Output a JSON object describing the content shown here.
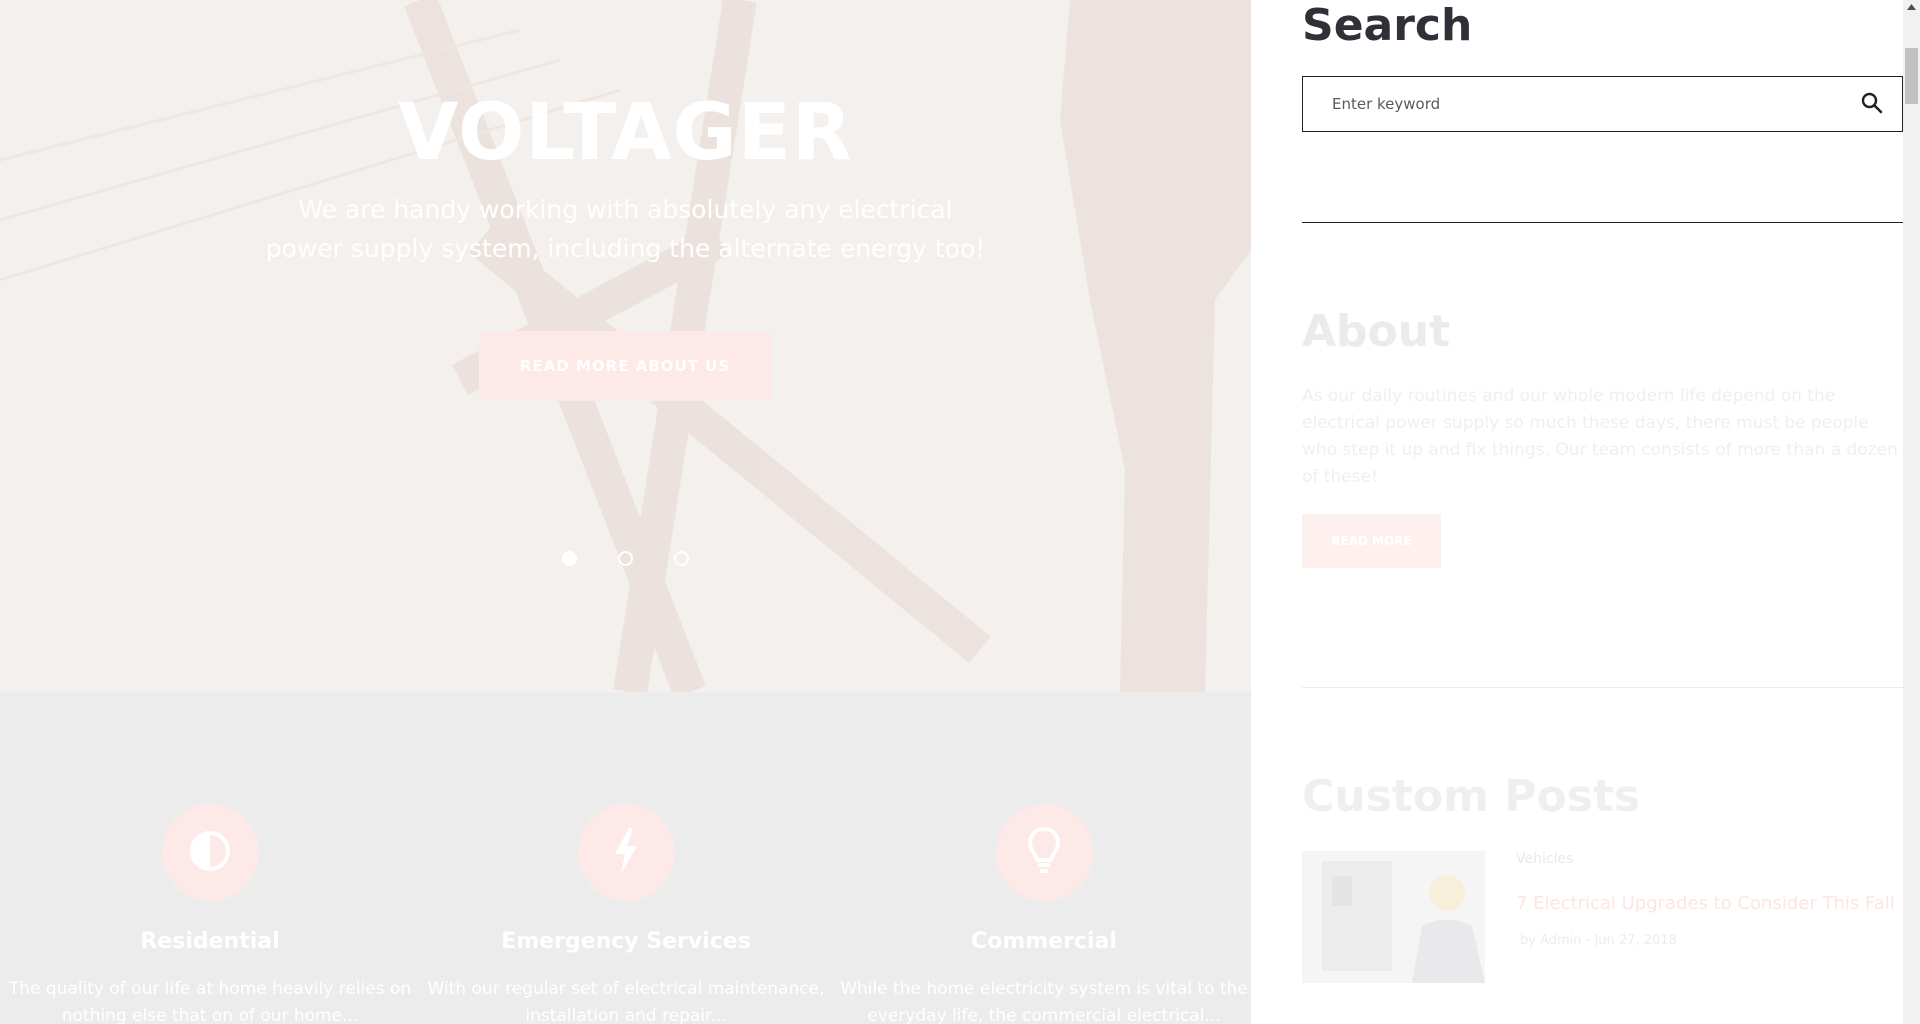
{
  "hero": {
    "title": "VOLTAGER",
    "subtitle": "We are handy working with absolutely any electrical power supply system, including the alternate energy too!",
    "button_label": "READ MORE ABOUT US",
    "slides_total": 3,
    "slide_active": 1
  },
  "services": [
    {
      "title": "Residential",
      "icon": "half-circle-icon",
      "description": "The quality of our life at home heavily relies on nothing else that on of our home..."
    },
    {
      "title": "Emergency Services",
      "icon": "lightning-icon",
      "description": "With our regular set of electrical maintenance, installation and repair..."
    },
    {
      "title": "Commercial",
      "icon": "lightbulb-icon",
      "description": "While the home electricity system is vital to the everyday life, the commercial electrical..."
    }
  ],
  "sidebar": {
    "search": {
      "title": "Search",
      "placeholder": "Enter keyword",
      "icon": "search-icon"
    },
    "about": {
      "title": "About",
      "text": "As our daily routines and our whole modern life depend on the electrical power supply so much these days, there must be people who step it up and fix things. Our team consists of more than a dozen of these!",
      "button_label": "READ MORE"
    },
    "custom_posts": {
      "title": "Custom Posts",
      "posts": [
        {
          "category": "Vehicles",
          "title": "7 Electrical Upgrades to Consider This Fall",
          "meta": "by Admin  -  Jun 27, 2018"
        }
      ]
    }
  },
  "colors": {
    "accent_pink": "#fde9e7",
    "heading_dark": "#2f3038",
    "hero_bg": "#f3f0ee",
    "services_bg": "#ececec"
  }
}
